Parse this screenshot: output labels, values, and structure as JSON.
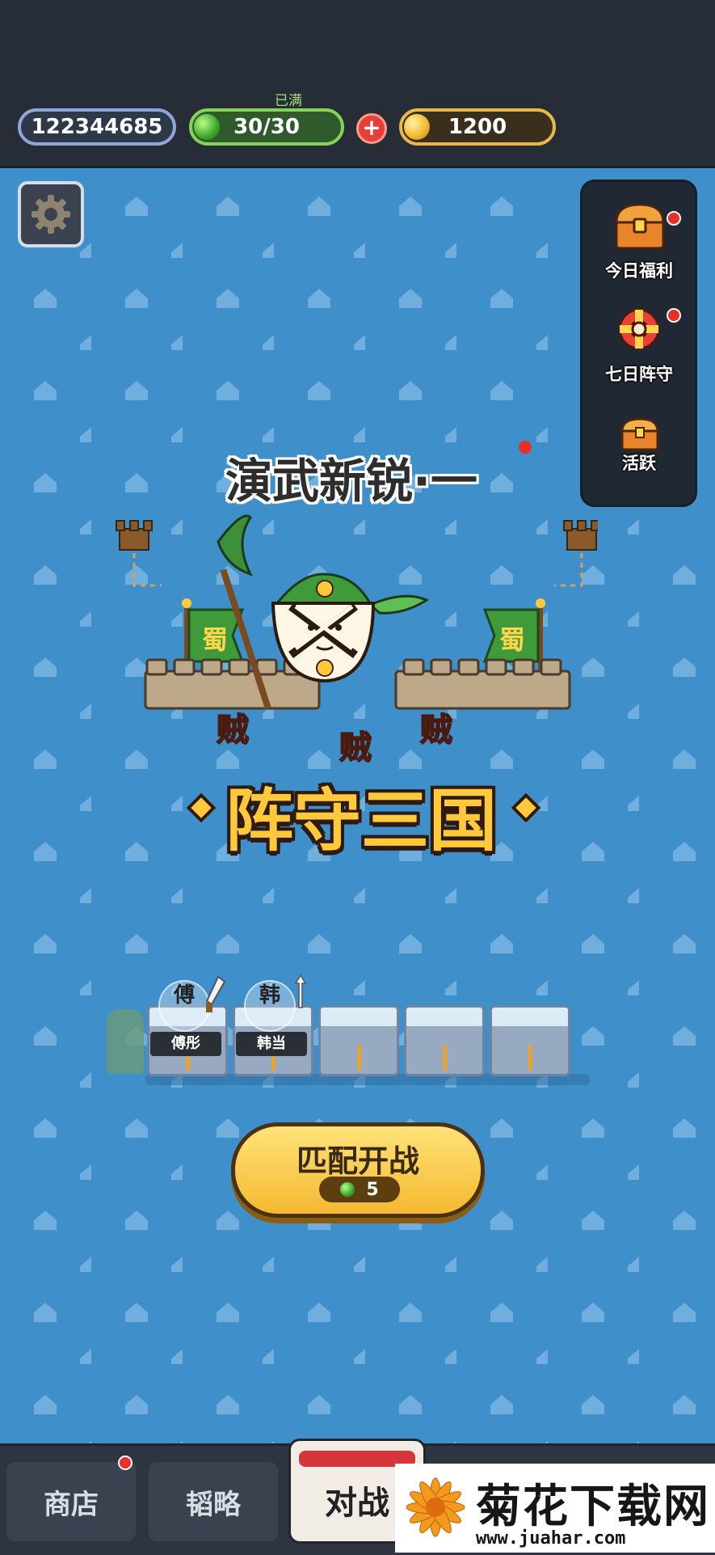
{
  "header": {
    "player_id": "122344685",
    "energy_status": "已满",
    "energy": "30/30",
    "add_label": "+",
    "gold": "1200"
  },
  "side_menu": {
    "items": [
      {
        "label": "今日福利",
        "icon": "treasure-chest-icon",
        "badge": true
      },
      {
        "label": "七日阵守",
        "icon": "lifebuoy-gift-icon",
        "badge": true
      },
      {
        "label": "活跃",
        "icon": "small-chest-icon",
        "badge": false
      }
    ]
  },
  "banner": {
    "subtitle": "演武新锐·一",
    "game_title": "阵守三国",
    "flag_text": "蜀",
    "enemy_text": "贼"
  },
  "lineup": {
    "heroes": [
      {
        "glyph": "傅",
        "name": "傅彤"
      },
      {
        "glyph": "韩",
        "name": "韩当"
      }
    ],
    "slot_count": 5
  },
  "match": {
    "label": "匹配开战",
    "cost": "5"
  },
  "bottom_nav": {
    "tabs": [
      {
        "label": "商店",
        "badge": true
      },
      {
        "label": "韬略",
        "badge": false
      },
      {
        "label": "对战",
        "active": true
      }
    ]
  },
  "watermark": {
    "brand": "菊花下载网",
    "url": "www.juahar.com"
  },
  "colors": {
    "background": "#3f8fca",
    "topbar": "#262d36",
    "gold": "#ffc93b",
    "accent_red": "#e8302b"
  }
}
